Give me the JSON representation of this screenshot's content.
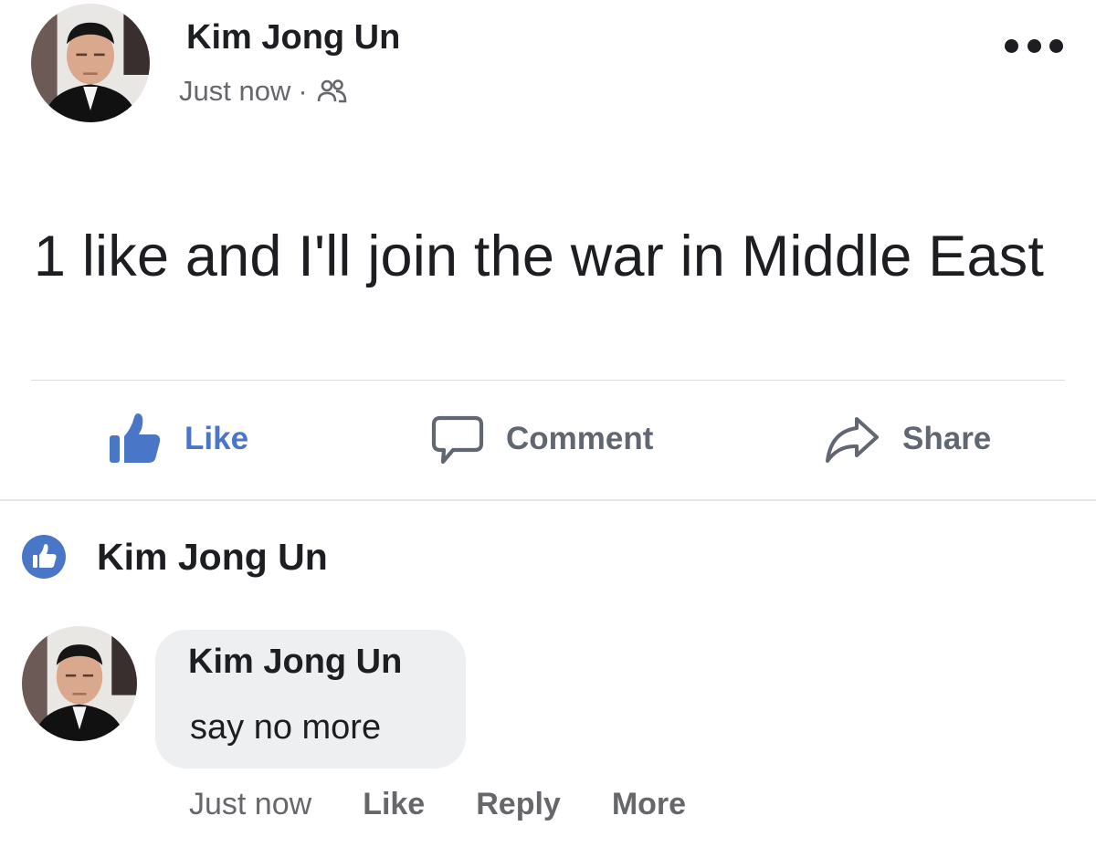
{
  "post": {
    "author": "Kim Jong Un",
    "time": "Just now",
    "separator": "·",
    "audience_icon": "friends-icon",
    "menu_icon": "more-dots-icon",
    "text": "1 like and I'll join the war in Middle East"
  },
  "actions": {
    "like": "Like",
    "comment": "Comment",
    "share": "Share"
  },
  "reactions": {
    "icon": "like-badge-icon",
    "reactor": "Kim Jong Un"
  },
  "comment": {
    "author": "Kim Jong Un",
    "text": "say no more",
    "time": "Just now",
    "like": "Like",
    "reply": "Reply",
    "more": "More"
  },
  "colors": {
    "like_blue": "#4a76c8",
    "muted_text": "#65676b",
    "bubble": "#eeeff1"
  }
}
